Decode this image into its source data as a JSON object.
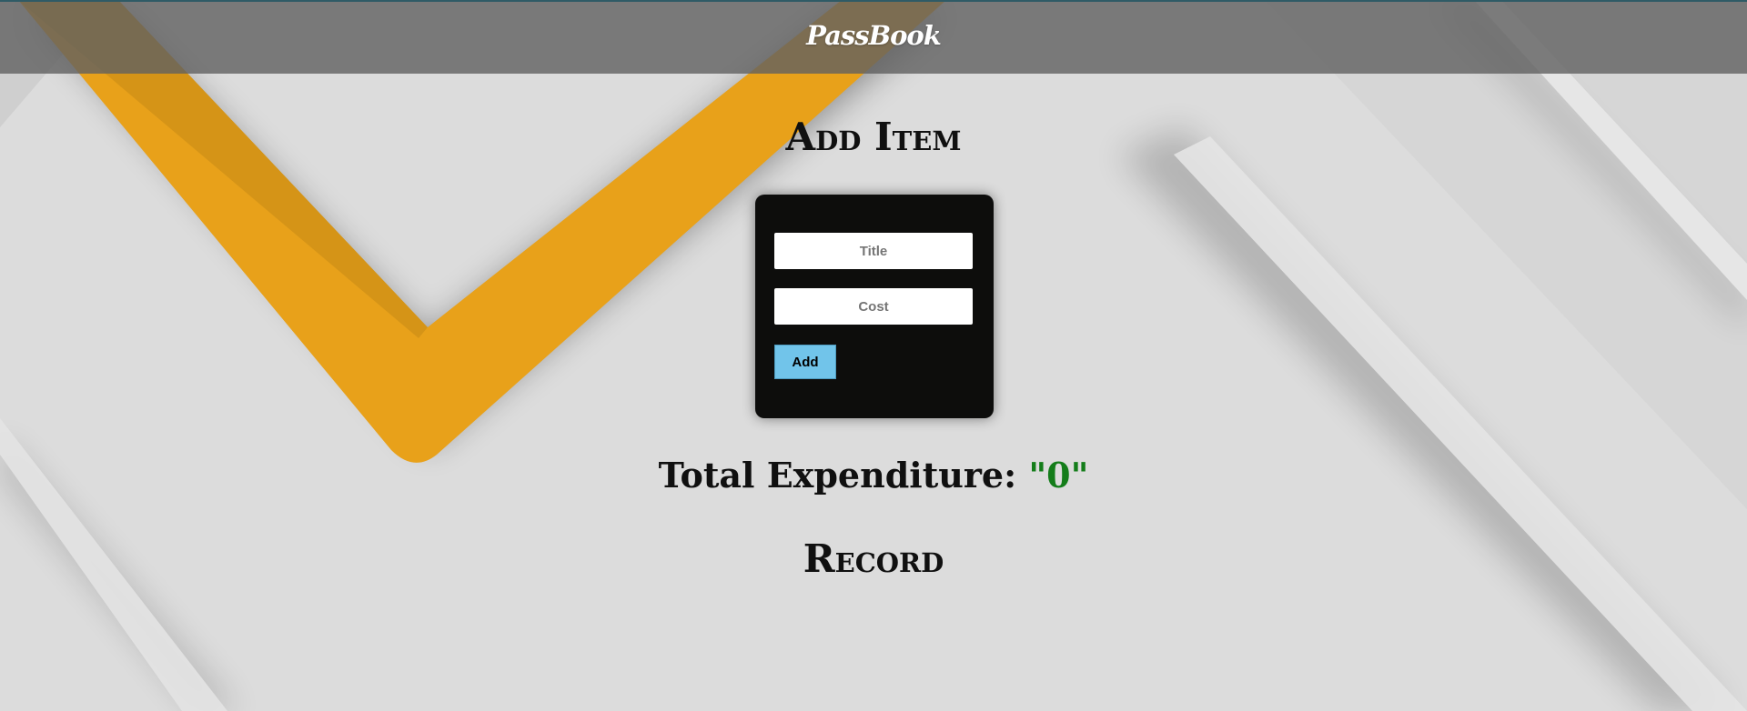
{
  "header": {
    "brand": "PassBook"
  },
  "add_item": {
    "title": "Add Item",
    "title_placeholder": "Title",
    "cost_placeholder": "Cost",
    "add_label": "Add"
  },
  "summary": {
    "label": "Total Expenditure: ",
    "value": "\"0\""
  },
  "record": {
    "title": "Record"
  },
  "colors": {
    "accent_orange": "#e8a11a",
    "button_blue": "#71c4ea",
    "total_green": "#147d1a",
    "card_black": "#0d0d0c"
  }
}
